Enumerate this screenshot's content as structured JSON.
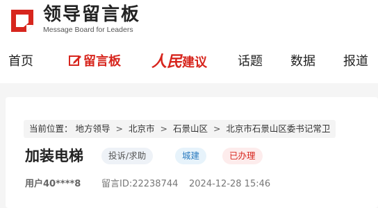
{
  "brand": {
    "title": "领导留言板",
    "subtitle": "Message Board for Leaders",
    "logo_icon": "leaders-message-board-logo",
    "accent_color": "#d7261e"
  },
  "nav": {
    "items": [
      {
        "label": "首页"
      },
      {
        "label": "留言板",
        "icon": "edit-icon",
        "active": true
      },
      {
        "label_prefix": "人民",
        "label": "建议"
      },
      {
        "label": "话题"
      },
      {
        "label": "数据"
      },
      {
        "label": "报道"
      }
    ]
  },
  "breadcrumb": {
    "prefix": "当前位置：",
    "items": [
      "地方领导",
      "北京市",
      "石景山区",
      "北京市石景山区委书记常卫"
    ],
    "separator": ">"
  },
  "message": {
    "title": "加装电梯",
    "tags": [
      "投诉/求助",
      "城建",
      "已办理"
    ],
    "user": "用户40****8",
    "message_id": "留言ID:22238744",
    "datetime": "2024-12-28 15:46"
  }
}
